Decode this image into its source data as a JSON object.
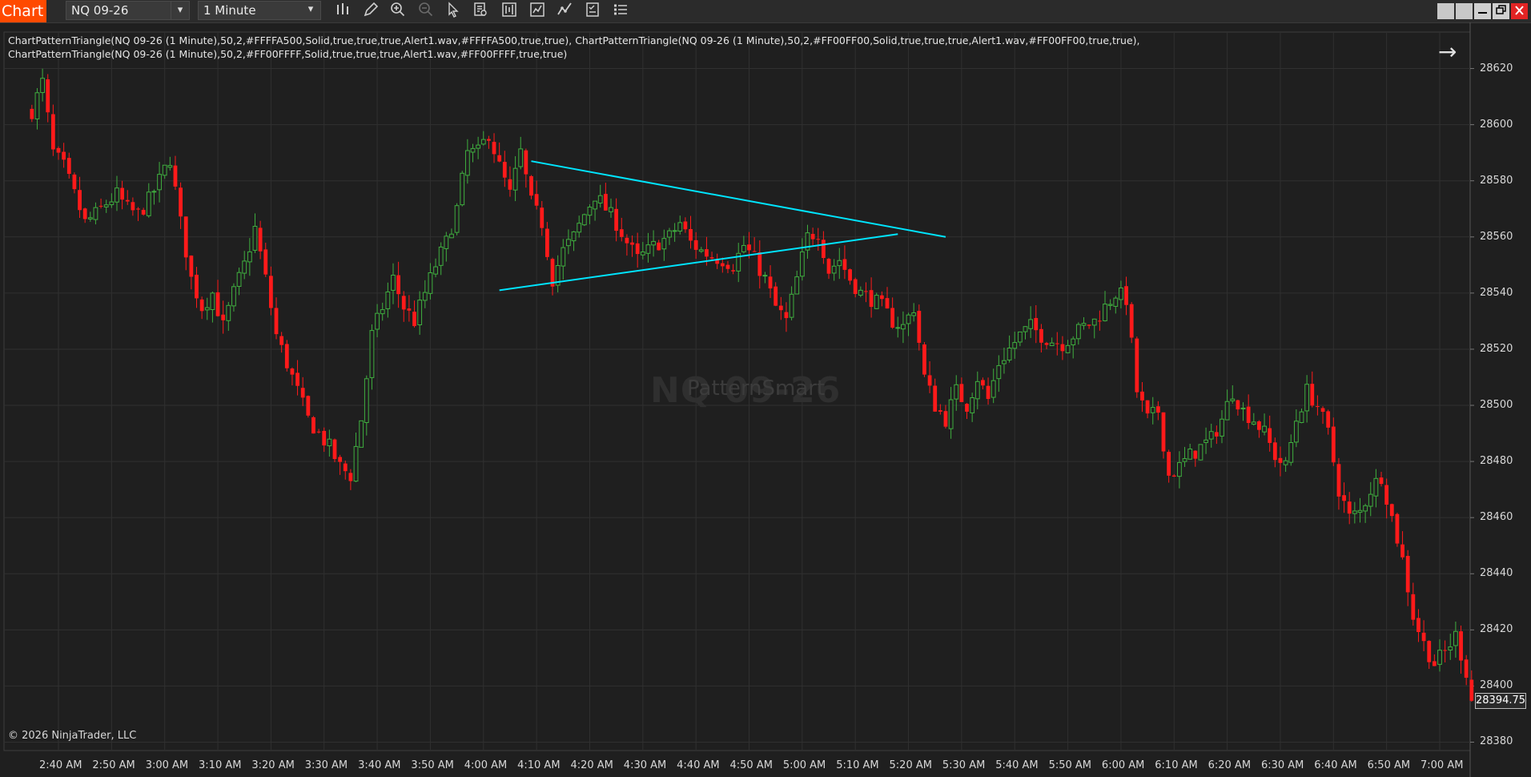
{
  "toolbar": {
    "brand": "Chart",
    "instrument": "NQ 09-26",
    "interval": "1 Minute",
    "icons": [
      "bar-type-icon",
      "draw-pencil-icon",
      "zoom-in-icon",
      "zoom-out-icon",
      "pointer-icon",
      "data-box-icon",
      "chart-style-icon",
      "indicators-icon",
      "strategies-icon",
      "templates-icon",
      "properties-list-icon"
    ]
  },
  "window_buttons": [
    "tile-icon",
    "tile-icon",
    "minimize-icon",
    "restore-icon",
    "close-icon"
  ],
  "indicator_label": "ChartPatternTriangle(NQ 09-26 (1 Minute),50,2,#FFFFA500,Solid,true,true,true,Alert1.wav,#FFFFA500,true,true), ChartPatternTriangle(NQ 09-26 (1 Minute),50,2,#FF00FF00,Solid,true,true,true,Alert1.wav,#FF00FF00,true,true), ChartPatternTriangle(NQ 09-26 (1 Minute),50,2,#FF00FFFF,Solid,true,true,true,Alert1.wav,#FF00FFFF,true,true)",
  "watermark": "NQ 09-26",
  "watermark_sub": "PatternSmart",
  "copyright": "© 2026 NinjaTrader, LLC",
  "last_price": "28394.75",
  "colors": {
    "up": "#3fae3f",
    "down": "#ff1a1a",
    "triangle": "#00e5ff",
    "grid": "#303030",
    "background": "#1f1f1f"
  },
  "chart_data": {
    "type": "candlestick",
    "instrument": "NQ 09-26",
    "interval": "1 Minute",
    "x_ticks": [
      "2:40 AM",
      "2:50 AM",
      "3:00 AM",
      "3:10 AM",
      "3:20 AM",
      "3:30 AM",
      "3:40 AM",
      "3:50 AM",
      "4:00 AM",
      "4:10 AM",
      "4:20 AM",
      "4:30 AM",
      "4:40 AM",
      "4:50 AM",
      "5:00 AM",
      "5:10 AM",
      "5:20 AM",
      "5:30 AM",
      "5:40 AM",
      "5:50 AM",
      "6:00 AM",
      "6:10 AM",
      "6:20 AM",
      "6:30 AM",
      "6:40 AM",
      "6:50 AM",
      "7:00 AM"
    ],
    "y_ticks": [
      28620,
      28600,
      28580,
      28560,
      28540,
      28520,
      28500,
      28480,
      28460,
      28440,
      28420,
      28400,
      28380
    ],
    "ylim": [
      28377,
      28633
    ],
    "close_path": [
      [
        "2:35 AM",
        28605
      ],
      [
        "2:37 AM",
        28615
      ],
      [
        "2:39 AM",
        28590
      ],
      [
        "2:41 AM",
        28585
      ],
      [
        "2:43 AM",
        28575
      ],
      [
        "2:45 AM",
        28565
      ],
      [
        "2:47 AM",
        28568
      ],
      [
        "2:49 AM",
        28572
      ],
      [
        "2:51 AM",
        28575
      ],
      [
        "2:53 AM",
        28570
      ],
      [
        "2:55 AM",
        28568
      ],
      [
        "2:57 AM",
        28573
      ],
      [
        "2:59 AM",
        28580
      ],
      [
        "3:01 AM",
        28588
      ],
      [
        "3:03 AM",
        28565
      ],
      [
        "3:05 AM",
        28545
      ],
      [
        "3:07 AM",
        28535
      ],
      [
        "3:09 AM",
        28540
      ],
      [
        "3:11 AM",
        28528
      ],
      [
        "3:13 AM",
        28540
      ],
      [
        "3:15 AM",
        28550
      ],
      [
        "3:17 AM",
        28563
      ],
      [
        "3:19 AM",
        28545
      ],
      [
        "3:21 AM",
        28525
      ],
      [
        "3:23 AM",
        28515
      ],
      [
        "3:25 AM",
        28505
      ],
      [
        "3:27 AM",
        28495
      ],
      [
        "3:29 AM",
        28490
      ],
      [
        "3:31 AM",
        28485
      ],
      [
        "3:33 AM",
        28478
      ],
      [
        "3:35 AM",
        28475
      ],
      [
        "3:37 AM",
        28495
      ],
      [
        "3:39 AM",
        28525
      ],
      [
        "3:41 AM",
        28535
      ],
      [
        "3:43 AM",
        28545
      ],
      [
        "3:45 AM",
        28535
      ],
      [
        "3:47 AM",
        28530
      ],
      [
        "3:49 AM",
        28540
      ],
      [
        "3:51 AM",
        28550
      ],
      [
        "3:53 AM",
        28558
      ],
      [
        "3:55 AM",
        28570
      ],
      [
        "3:57 AM",
        28590
      ],
      [
        "3:59 AM",
        28590
      ],
      [
        "4:01 AM",
        28597
      ],
      [
        "4:03 AM",
        28585
      ],
      [
        "4:05 AM",
        28575
      ],
      [
        "4:07 AM",
        28590
      ],
      [
        "4:09 AM",
        28572
      ],
      [
        "4:11 AM",
        28565
      ],
      [
        "4:13 AM",
        28545
      ],
      [
        "4:15 AM",
        28555
      ],
      [
        "4:17 AM",
        28560
      ],
      [
        "4:19 AM",
        28568
      ],
      [
        "4:21 AM",
        28575
      ],
      [
        "4:23 AM",
        28570
      ],
      [
        "4:25 AM",
        28565
      ],
      [
        "4:27 AM",
        28558
      ],
      [
        "4:29 AM",
        28552
      ],
      [
        "4:31 AM",
        28555
      ],
      [
        "4:33 AM",
        28558
      ],
      [
        "4:35 AM",
        28560
      ],
      [
        "4:37 AM",
        28565
      ],
      [
        "4:39 AM",
        28558
      ],
      [
        "4:41 AM",
        28555
      ],
      [
        "4:43 AM",
        28553
      ],
      [
        "4:45 AM",
        28552
      ],
      [
        "4:47 AM",
        28550
      ],
      [
        "4:49 AM",
        28557
      ],
      [
        "4:51 AM",
        28552
      ],
      [
        "4:53 AM",
        28545
      ],
      [
        "4:55 AM",
        28535
      ],
      [
        "4:57 AM",
        28530
      ],
      [
        "4:59 AM",
        28545
      ],
      [
        "5:01 AM",
        28560
      ],
      [
        "5:03 AM",
        28562
      ],
      [
        "5:05 AM",
        28548
      ],
      [
        "5:07 AM",
        28552
      ],
      [
        "5:09 AM",
        28545
      ],
      [
        "5:11 AM",
        28540
      ],
      [
        "5:13 AM",
        28538
      ],
      [
        "5:15 AM",
        28535
      ],
      [
        "5:17 AM",
        28530
      ],
      [
        "5:19 AM",
        28528
      ],
      [
        "5:21 AM",
        28535
      ],
      [
        "5:23 AM",
        28510
      ],
      [
        "5:25 AM",
        28500
      ],
      [
        "5:27 AM",
        28495
      ],
      [
        "5:29 AM",
        28505
      ],
      [
        "5:31 AM",
        28500
      ],
      [
        "5:33 AM",
        28510
      ],
      [
        "5:35 AM",
        28502
      ],
      [
        "5:37 AM",
        28515
      ],
      [
        "5:39 AM",
        28520
      ],
      [
        "5:41 AM",
        28525
      ],
      [
        "5:43 AM",
        28528
      ],
      [
        "5:45 AM",
        28525
      ],
      [
        "5:47 AM",
        28523
      ],
      [
        "5:49 AM",
        28522
      ],
      [
        "5:51 AM",
        28525
      ],
      [
        "5:53 AM",
        28528
      ],
      [
        "5:55 AM",
        28530
      ],
      [
        "5:57 AM",
        28535
      ],
      [
        "5:59 AM",
        28540
      ],
      [
        "6:01 AM",
        28538
      ],
      [
        "6:03 AM",
        28505
      ],
      [
        "6:05 AM",
        28495
      ],
      [
        "6:07 AM",
        28498
      ],
      [
        "6:09 AM",
        28475
      ],
      [
        "6:11 AM",
        28478
      ],
      [
        "6:13 AM",
        28482
      ],
      [
        "6:15 AM",
        28485
      ],
      [
        "6:17 AM",
        28488
      ],
      [
        "6:19 AM",
        28495
      ],
      [
        "6:21 AM",
        28505
      ],
      [
        "6:23 AM",
        28498
      ],
      [
        "6:25 AM",
        28495
      ],
      [
        "6:27 AM",
        28490
      ],
      [
        "6:29 AM",
        28482
      ],
      [
        "6:31 AM",
        28478
      ],
      [
        "6:33 AM",
        28495
      ],
      [
        "6:35 AM",
        28505
      ],
      [
        "6:37 AM",
        28500
      ],
      [
        "6:39 AM",
        28490
      ],
      [
        "6:41 AM",
        28470
      ],
      [
        "6:43 AM",
        28460
      ],
      [
        "6:45 AM",
        28462
      ],
      [
        "6:47 AM",
        28470
      ],
      [
        "6:49 AM",
        28475
      ],
      [
        "6:51 AM",
        28460
      ],
      [
        "6:53 AM",
        28445
      ],
      [
        "6:55 AM",
        28425
      ],
      [
        "6:57 AM",
        28415
      ],
      [
        "6:59 AM",
        28408
      ],
      [
        "7:01 AM",
        28412
      ],
      [
        "7:03 AM",
        28418
      ],
      [
        "7:05 AM",
        28405
      ],
      [
        "7:06 AM",
        28395
      ]
    ],
    "triangle": {
      "upper": [
        [
          "4:09 AM",
          28587
        ],
        [
          "5:27 AM",
          28560
        ]
      ],
      "lower": [
        [
          "4:03 AM",
          28541
        ],
        [
          "5:18 AM",
          28561
        ]
      ]
    },
    "last_price": 28394.75
  }
}
